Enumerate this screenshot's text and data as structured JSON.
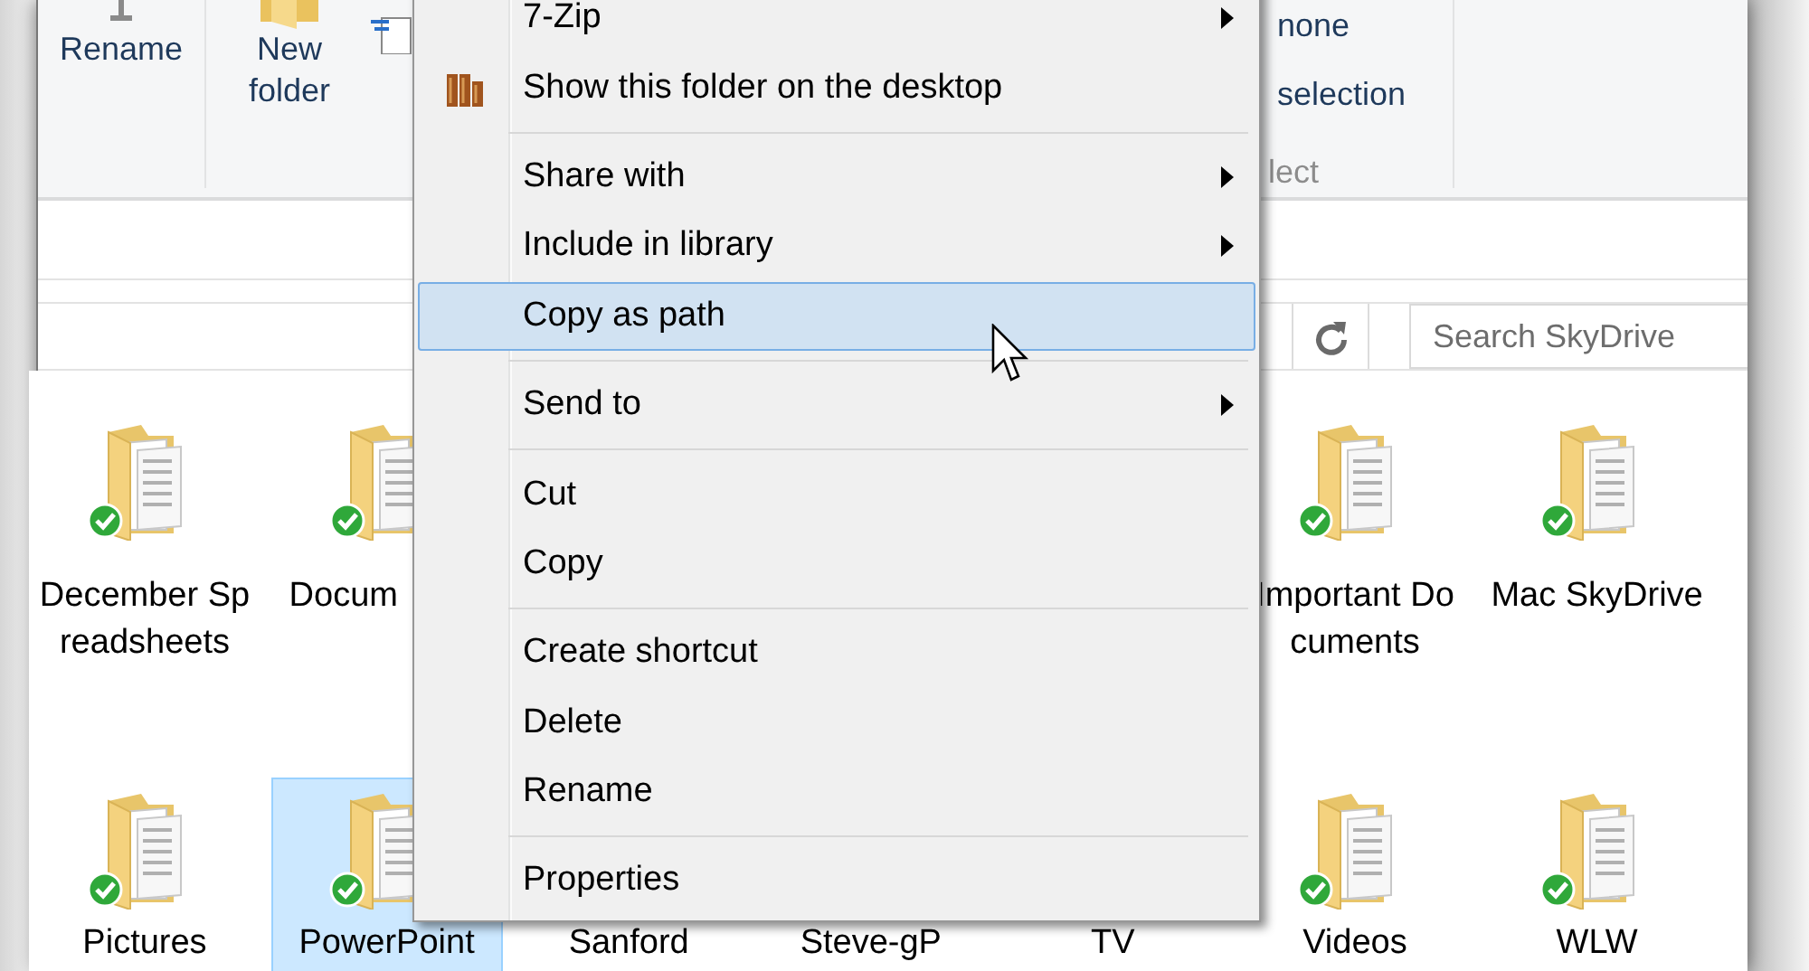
{
  "ribbon": {
    "buttons": [
      {
        "label": "Rename",
        "kind": "rename"
      },
      {
        "label": "New folder",
        "kind": "new-folder"
      }
    ],
    "commands": [
      "none",
      "selection"
    ],
    "right_group_label": "lect"
  },
  "address_bar": {
    "search": {
      "placeholder": "Search SkyDrive"
    }
  },
  "files": {
    "rows": [
      [
        {
          "name": "December Spreadsheets",
          "selected": false
        },
        {
          "name": "Docum",
          "selected": false
        },
        null,
        null,
        null,
        {
          "name": "Important Documents",
          "selected": false
        },
        {
          "name": "Mac SkyDrive",
          "selected": false
        }
      ],
      [
        {
          "name": "Pictures",
          "selected": false
        },
        {
          "name": "PowerPoint",
          "selected": true
        },
        {
          "name": "Sanford",
          "selected": false
        },
        {
          "name": "Steve-gP",
          "selected": false
        },
        {
          "name": "TV",
          "selected": false
        },
        {
          "name": "Videos",
          "selected": false
        },
        {
          "name": "WLW",
          "selected": false
        }
      ]
    ]
  },
  "context_menu": {
    "groups": [
      [
        {
          "label": "7-Zip",
          "has_icon": false,
          "submenu": true,
          "selected": false
        },
        {
          "label": "Show this folder on the desktop",
          "has_icon": true,
          "submenu": false,
          "selected": false
        }
      ],
      [
        {
          "label": "Share with",
          "has_icon": false,
          "submenu": true,
          "selected": false
        },
        {
          "label": "Include in library",
          "has_icon": false,
          "submenu": true,
          "selected": false
        },
        {
          "label": "Copy as path",
          "has_icon": false,
          "submenu": false,
          "selected": true
        }
      ],
      [
        {
          "label": "Send to",
          "has_icon": false,
          "submenu": true,
          "selected": false
        }
      ],
      [
        {
          "label": "Cut",
          "has_icon": false,
          "submenu": false,
          "selected": false
        },
        {
          "label": "Copy",
          "has_icon": false,
          "submenu": false,
          "selected": false
        }
      ],
      [
        {
          "label": "Create shortcut",
          "has_icon": false,
          "submenu": false,
          "selected": false
        },
        {
          "label": "Delete",
          "has_icon": false,
          "submenu": false,
          "selected": false
        },
        {
          "label": "Rename",
          "has_icon": false,
          "submenu": false,
          "selected": false
        }
      ],
      [
        {
          "label": "Properties",
          "has_icon": false,
          "submenu": false,
          "selected": false
        }
      ]
    ]
  }
}
